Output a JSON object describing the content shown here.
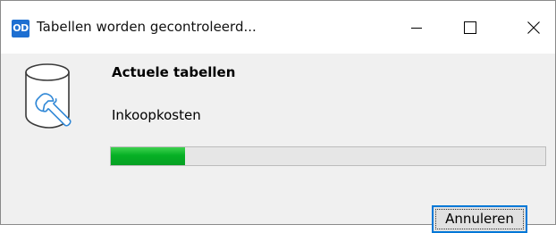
{
  "window": {
    "app_icon_text": "OD",
    "title": "Tabellen worden gecontroleerd...",
    "minimize_glyph": "minimize-icon",
    "maximize_glyph": "maximize-icon",
    "close_glyph": "close-icon"
  },
  "dialog": {
    "icon": "database-wrench-icon",
    "heading": "Actuele tabellen",
    "status": "Inkoopkosten",
    "progress": 0.17,
    "progress_color": "#06b025",
    "cancel_label": "Annuleren",
    "accent_color": "#0078d7"
  }
}
